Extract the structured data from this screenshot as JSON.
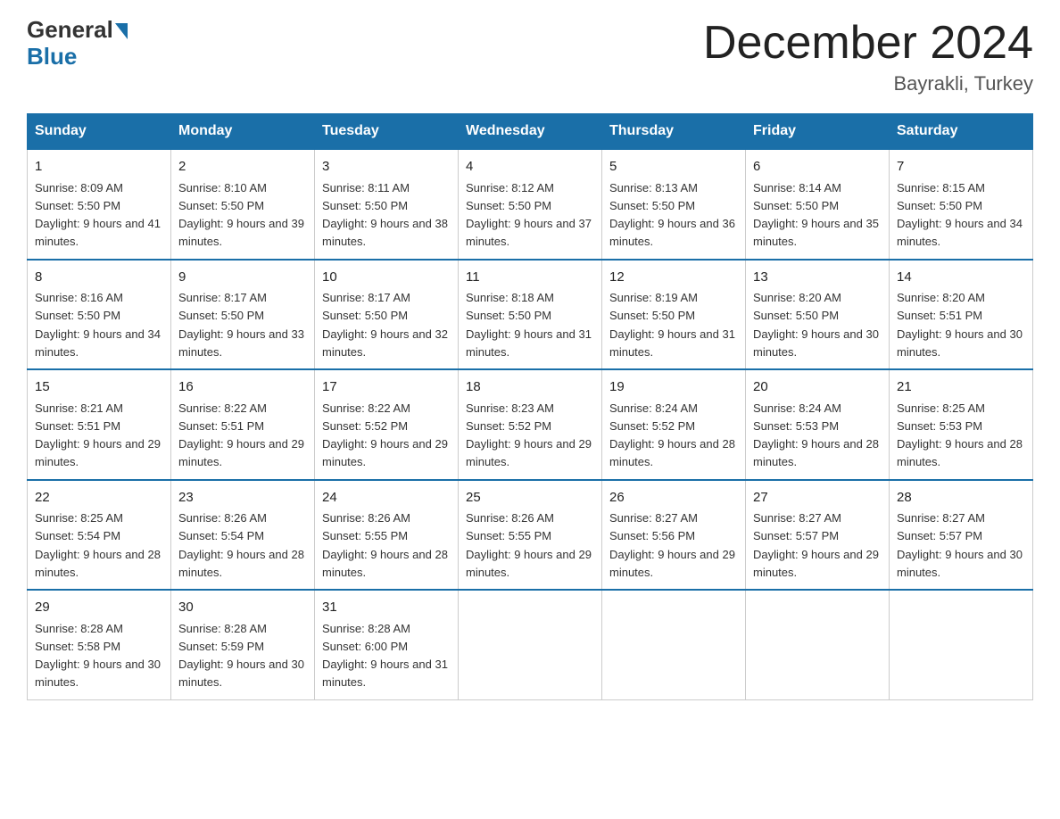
{
  "logo": {
    "general": "General",
    "blue": "Blue"
  },
  "title": "December 2024",
  "subtitle": "Bayrakli, Turkey",
  "headers": [
    "Sunday",
    "Monday",
    "Tuesday",
    "Wednesday",
    "Thursday",
    "Friday",
    "Saturday"
  ],
  "weeks": [
    [
      {
        "day": "1",
        "sunrise": "8:09 AM",
        "sunset": "5:50 PM",
        "daylight": "9 hours and 41 minutes."
      },
      {
        "day": "2",
        "sunrise": "8:10 AM",
        "sunset": "5:50 PM",
        "daylight": "9 hours and 39 minutes."
      },
      {
        "day": "3",
        "sunrise": "8:11 AM",
        "sunset": "5:50 PM",
        "daylight": "9 hours and 38 minutes."
      },
      {
        "day": "4",
        "sunrise": "8:12 AM",
        "sunset": "5:50 PM",
        "daylight": "9 hours and 37 minutes."
      },
      {
        "day": "5",
        "sunrise": "8:13 AM",
        "sunset": "5:50 PM",
        "daylight": "9 hours and 36 minutes."
      },
      {
        "day": "6",
        "sunrise": "8:14 AM",
        "sunset": "5:50 PM",
        "daylight": "9 hours and 35 minutes."
      },
      {
        "day": "7",
        "sunrise": "8:15 AM",
        "sunset": "5:50 PM",
        "daylight": "9 hours and 34 minutes."
      }
    ],
    [
      {
        "day": "8",
        "sunrise": "8:16 AM",
        "sunset": "5:50 PM",
        "daylight": "9 hours and 34 minutes."
      },
      {
        "day": "9",
        "sunrise": "8:17 AM",
        "sunset": "5:50 PM",
        "daylight": "9 hours and 33 minutes."
      },
      {
        "day": "10",
        "sunrise": "8:17 AM",
        "sunset": "5:50 PM",
        "daylight": "9 hours and 32 minutes."
      },
      {
        "day": "11",
        "sunrise": "8:18 AM",
        "sunset": "5:50 PM",
        "daylight": "9 hours and 31 minutes."
      },
      {
        "day": "12",
        "sunrise": "8:19 AM",
        "sunset": "5:50 PM",
        "daylight": "9 hours and 31 minutes."
      },
      {
        "day": "13",
        "sunrise": "8:20 AM",
        "sunset": "5:50 PM",
        "daylight": "9 hours and 30 minutes."
      },
      {
        "day": "14",
        "sunrise": "8:20 AM",
        "sunset": "5:51 PM",
        "daylight": "9 hours and 30 minutes."
      }
    ],
    [
      {
        "day": "15",
        "sunrise": "8:21 AM",
        "sunset": "5:51 PM",
        "daylight": "9 hours and 29 minutes."
      },
      {
        "day": "16",
        "sunrise": "8:22 AM",
        "sunset": "5:51 PM",
        "daylight": "9 hours and 29 minutes."
      },
      {
        "day": "17",
        "sunrise": "8:22 AM",
        "sunset": "5:52 PM",
        "daylight": "9 hours and 29 minutes."
      },
      {
        "day": "18",
        "sunrise": "8:23 AM",
        "sunset": "5:52 PM",
        "daylight": "9 hours and 29 minutes."
      },
      {
        "day": "19",
        "sunrise": "8:24 AM",
        "sunset": "5:52 PM",
        "daylight": "9 hours and 28 minutes."
      },
      {
        "day": "20",
        "sunrise": "8:24 AM",
        "sunset": "5:53 PM",
        "daylight": "9 hours and 28 minutes."
      },
      {
        "day": "21",
        "sunrise": "8:25 AM",
        "sunset": "5:53 PM",
        "daylight": "9 hours and 28 minutes."
      }
    ],
    [
      {
        "day": "22",
        "sunrise": "8:25 AM",
        "sunset": "5:54 PM",
        "daylight": "9 hours and 28 minutes."
      },
      {
        "day": "23",
        "sunrise": "8:26 AM",
        "sunset": "5:54 PM",
        "daylight": "9 hours and 28 minutes."
      },
      {
        "day": "24",
        "sunrise": "8:26 AM",
        "sunset": "5:55 PM",
        "daylight": "9 hours and 28 minutes."
      },
      {
        "day": "25",
        "sunrise": "8:26 AM",
        "sunset": "5:55 PM",
        "daylight": "9 hours and 29 minutes."
      },
      {
        "day": "26",
        "sunrise": "8:27 AM",
        "sunset": "5:56 PM",
        "daylight": "9 hours and 29 minutes."
      },
      {
        "day": "27",
        "sunrise": "8:27 AM",
        "sunset": "5:57 PM",
        "daylight": "9 hours and 29 minutes."
      },
      {
        "day": "28",
        "sunrise": "8:27 AM",
        "sunset": "5:57 PM",
        "daylight": "9 hours and 30 minutes."
      }
    ],
    [
      {
        "day": "29",
        "sunrise": "8:28 AM",
        "sunset": "5:58 PM",
        "daylight": "9 hours and 30 minutes."
      },
      {
        "day": "30",
        "sunrise": "8:28 AM",
        "sunset": "5:59 PM",
        "daylight": "9 hours and 30 minutes."
      },
      {
        "day": "31",
        "sunrise": "8:28 AM",
        "sunset": "6:00 PM",
        "daylight": "9 hours and 31 minutes."
      },
      null,
      null,
      null,
      null
    ]
  ]
}
